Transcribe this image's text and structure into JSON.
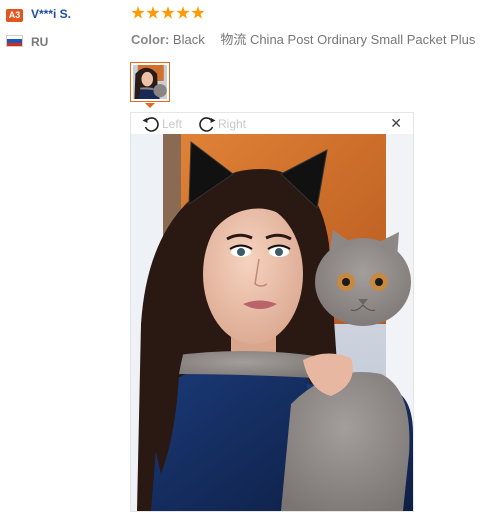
{
  "reviewer": {
    "level_badge": "A3",
    "name": "V***i S.",
    "country_code": "RU"
  },
  "review": {
    "rating": 5,
    "color_label": "Color:",
    "color_value": "Black",
    "shipping_value": "物流 China Post Ordinary Small Packet Plus"
  },
  "image_viewer": {
    "rotate_left_label": "Left",
    "rotate_right_label": "Right",
    "close_glyph": "✕"
  },
  "colors": {
    "accent_orange": "#ff9a00",
    "thumb_border": "#e46a1a",
    "name_link": "#1d4fa0",
    "badge_bg": "#e3551f"
  }
}
